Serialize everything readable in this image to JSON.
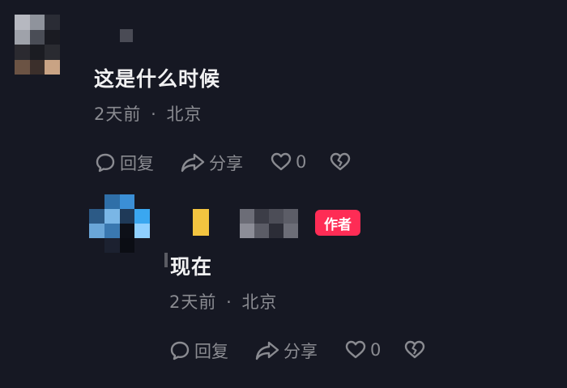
{
  "comment": {
    "text": "这是什么时候",
    "time": "2天前",
    "separator": "·",
    "location": "北京",
    "actions": {
      "reply_label": "回复",
      "share_label": "分享",
      "like_count": "0"
    }
  },
  "reply": {
    "author_badge": "作者",
    "text": "现在",
    "time": "2天前",
    "separator": "·",
    "location": "北京",
    "actions": {
      "reply_label": "回复",
      "share_label": "分享",
      "like_count": "0"
    }
  },
  "colors": {
    "background": "#161823",
    "author_badge": "#fe2c55",
    "muted_text": "#8a8b91"
  },
  "icons": [
    "comment-bubble-icon",
    "share-arrow-icon",
    "heart-icon",
    "broken-heart-icon"
  ]
}
